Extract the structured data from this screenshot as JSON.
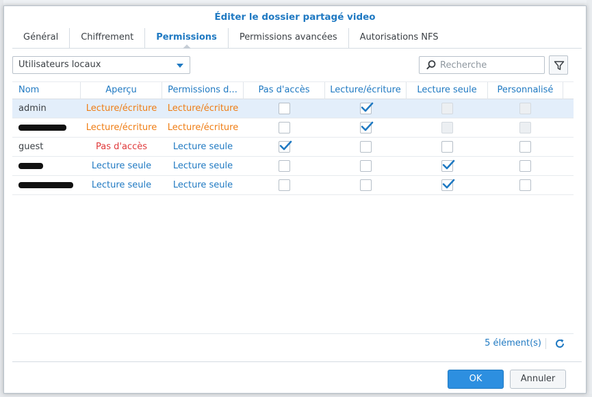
{
  "dialog": {
    "title": "Éditer le dossier partagé video"
  },
  "tabs": [
    {
      "label": "Général"
    },
    {
      "label": "Chiffrement"
    },
    {
      "label": "Permissions"
    },
    {
      "label": "Permissions avancées"
    },
    {
      "label": "Autorisations NFS"
    }
  ],
  "active_tab": "Permissions",
  "toolbar": {
    "user_type_selected": "Utilisateurs locaux",
    "search_placeholder": "Recherche"
  },
  "table": {
    "headers": [
      "Nom",
      "Aperçu",
      "Permissions d...",
      "Pas d'accès",
      "Lecture/écriture",
      "Lecture seule",
      "Personnalisé"
    ],
    "rows": [
      {
        "name": "admin",
        "apercu": "Lecture/écriture",
        "permission": "Lecture/écriture",
        "no_access": false,
        "read_write": true,
        "read_only": false,
        "custom": false,
        "selected": true
      },
      {
        "name": "",
        "apercu": "Lecture/écriture",
        "permission": "Lecture/écriture",
        "no_access": false,
        "read_write": true,
        "read_only": false,
        "custom": false,
        "redacted": true
      },
      {
        "name": "guest",
        "apercu": "Pas d'accès",
        "permission": "Lecture seule",
        "no_access": true,
        "read_write": false,
        "read_only": false,
        "custom": false
      },
      {
        "name": "",
        "apercu": "Lecture seule",
        "permission": "Lecture seule",
        "no_access": false,
        "read_write": false,
        "read_only": true,
        "custom": false,
        "redacted": true
      },
      {
        "name": "",
        "apercu": "Lecture seule",
        "permission": "Lecture seule",
        "no_access": false,
        "read_write": false,
        "read_only": true,
        "custom": false,
        "redacted": true
      }
    ]
  },
  "footer": {
    "count": "5 élément(s)"
  },
  "buttons": {
    "ok": "OK",
    "cancel": "Annuler"
  },
  "colors": {
    "accent": "#1f79c2",
    "orange": "#ef7d14",
    "red": "#e0393a",
    "ok_button": "#2d8fe0"
  }
}
